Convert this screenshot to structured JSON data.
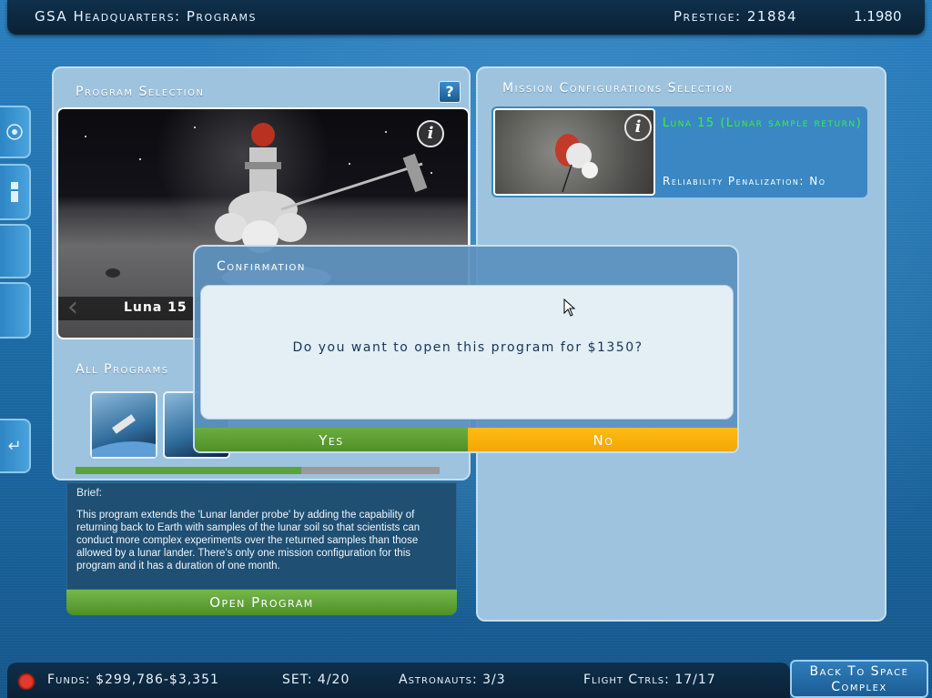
{
  "header": {
    "title": "GSA Headquarters:  Programs",
    "prestige": "Prestige: 21884",
    "date": "1.1980"
  },
  "program_selection": {
    "title": "Program Selection",
    "help_label": "?",
    "current_program": "Luna 15",
    "all_programs_label": "All Programs",
    "progress": 0.62
  },
  "brief": {
    "label": "Brief:",
    "text": "This program extends the 'Lunar lander probe' by adding the capability of returning back to Earth with samples of the lunar soil so that scientists can conduct more complex experiments over the returned samples than those allowed by a lunar lander. There's only one mission configuration for this program and it has a duration of one month."
  },
  "open_program_label": "Open Program",
  "mission_config": {
    "title": "Mission Configurations Selection",
    "mission_name": "Luna 15 (Lunar sample return)",
    "reliability": "Reliability Penalization: No"
  },
  "dialog": {
    "title": "Confirmation",
    "question": "Do you want to open this program for $1350?",
    "yes_label": "Yes",
    "no_label": "No"
  },
  "footer": {
    "funds": "Funds: $299,786-$3,351",
    "set": "SET: 4/20",
    "astronauts": "Astronauts: 3/3",
    "flight_ctrls": "Flight Ctrls: 17/17",
    "back_label": "Back To Space Complex"
  },
  "colors": {
    "accent_green": "#35f04a",
    "yes_green": "#5a9a30",
    "no_orange": "#f5ad00",
    "panel_bg": "#9dc3df"
  },
  "icons": [
    "info-icon",
    "help-icon",
    "arrow-left-icon",
    "return-icon",
    "bug-icon",
    "cursor-icon"
  ]
}
